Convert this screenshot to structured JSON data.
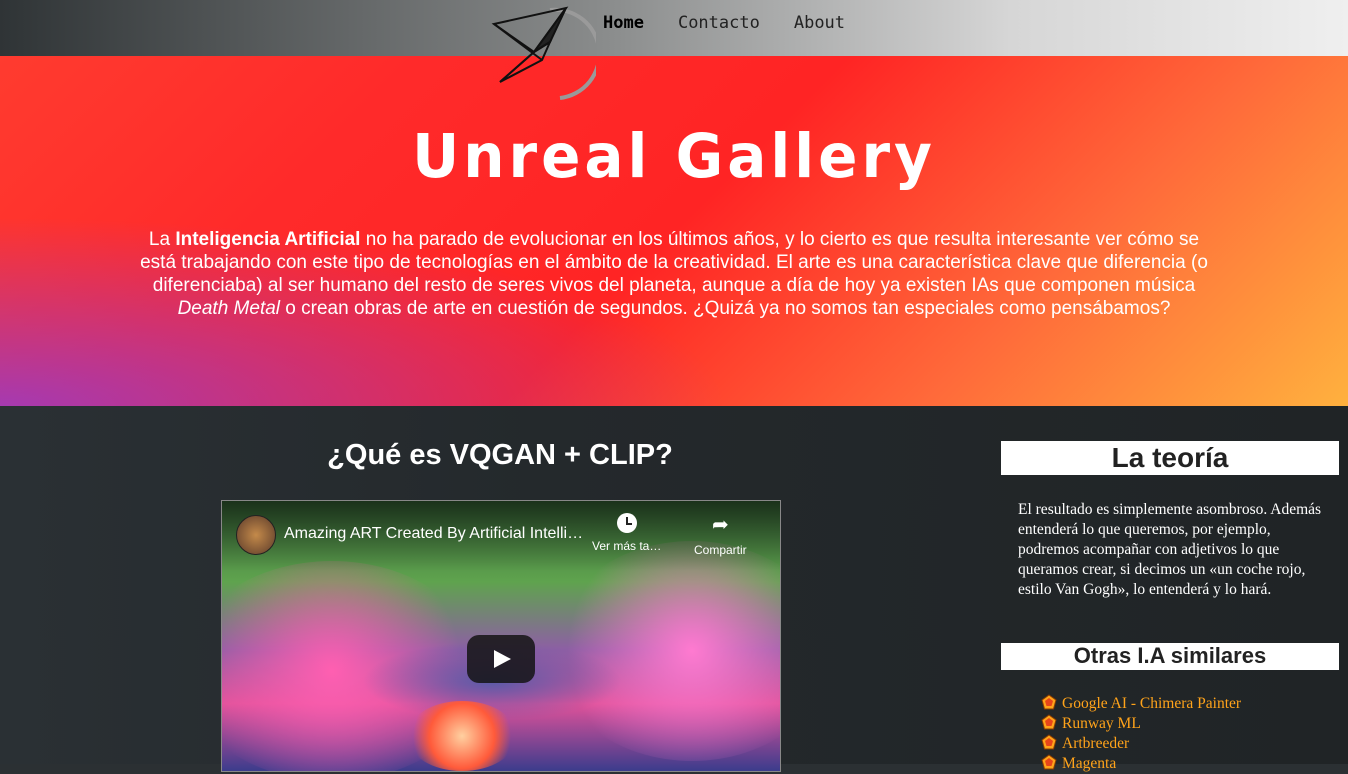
{
  "nav": {
    "items": [
      {
        "label": "Home"
      },
      {
        "label": "Contacto"
      },
      {
        "label": "About"
      }
    ]
  },
  "hero": {
    "title": "Unreal Gallery",
    "intro": {
      "t1": "La ",
      "b1": "Inteligencia Artificial",
      "t2": " no ha parado de evolucionar en los últimos años, y lo cierto es que resulta interesante ver cómo se está trabajando con este tipo de tecnologías en el ámbito de la creatividad. El arte es una característica clave que diferencia (o diferenciaba) al ser humano del resto de seres vivos del planeta, aunque a día de hoy ya existen IAs que componen música ",
      "i1": "Death Metal",
      "t3": " o crean obras de arte en cuestión de segundos. ¿Quizá ya no somos tan especiales como pensábamos?"
    }
  },
  "main": {
    "title": "¿Qué es VQGAN + CLIP?",
    "video": {
      "title": "Amazing ART Created By Artificial Intelligence",
      "watch_later": "Ver más ta…",
      "share": "Compartir"
    }
  },
  "sidebar": {
    "theory_title": "La teoría",
    "theory_text": "El resultado es simplemente asombroso. Además entenderá lo que queremos, por ejemplo, podremos acompañar con adjetivos lo que queramos crear, si decimos un «un coche rojo, estilo Van Gogh», lo entenderá y lo hará.",
    "others_title": "Otras I.A similares",
    "others": [
      {
        "label": "Google AI - Chimera Painter"
      },
      {
        "label": "Runway ML"
      },
      {
        "label": "Artbreeder"
      },
      {
        "label": "Magenta"
      }
    ]
  }
}
